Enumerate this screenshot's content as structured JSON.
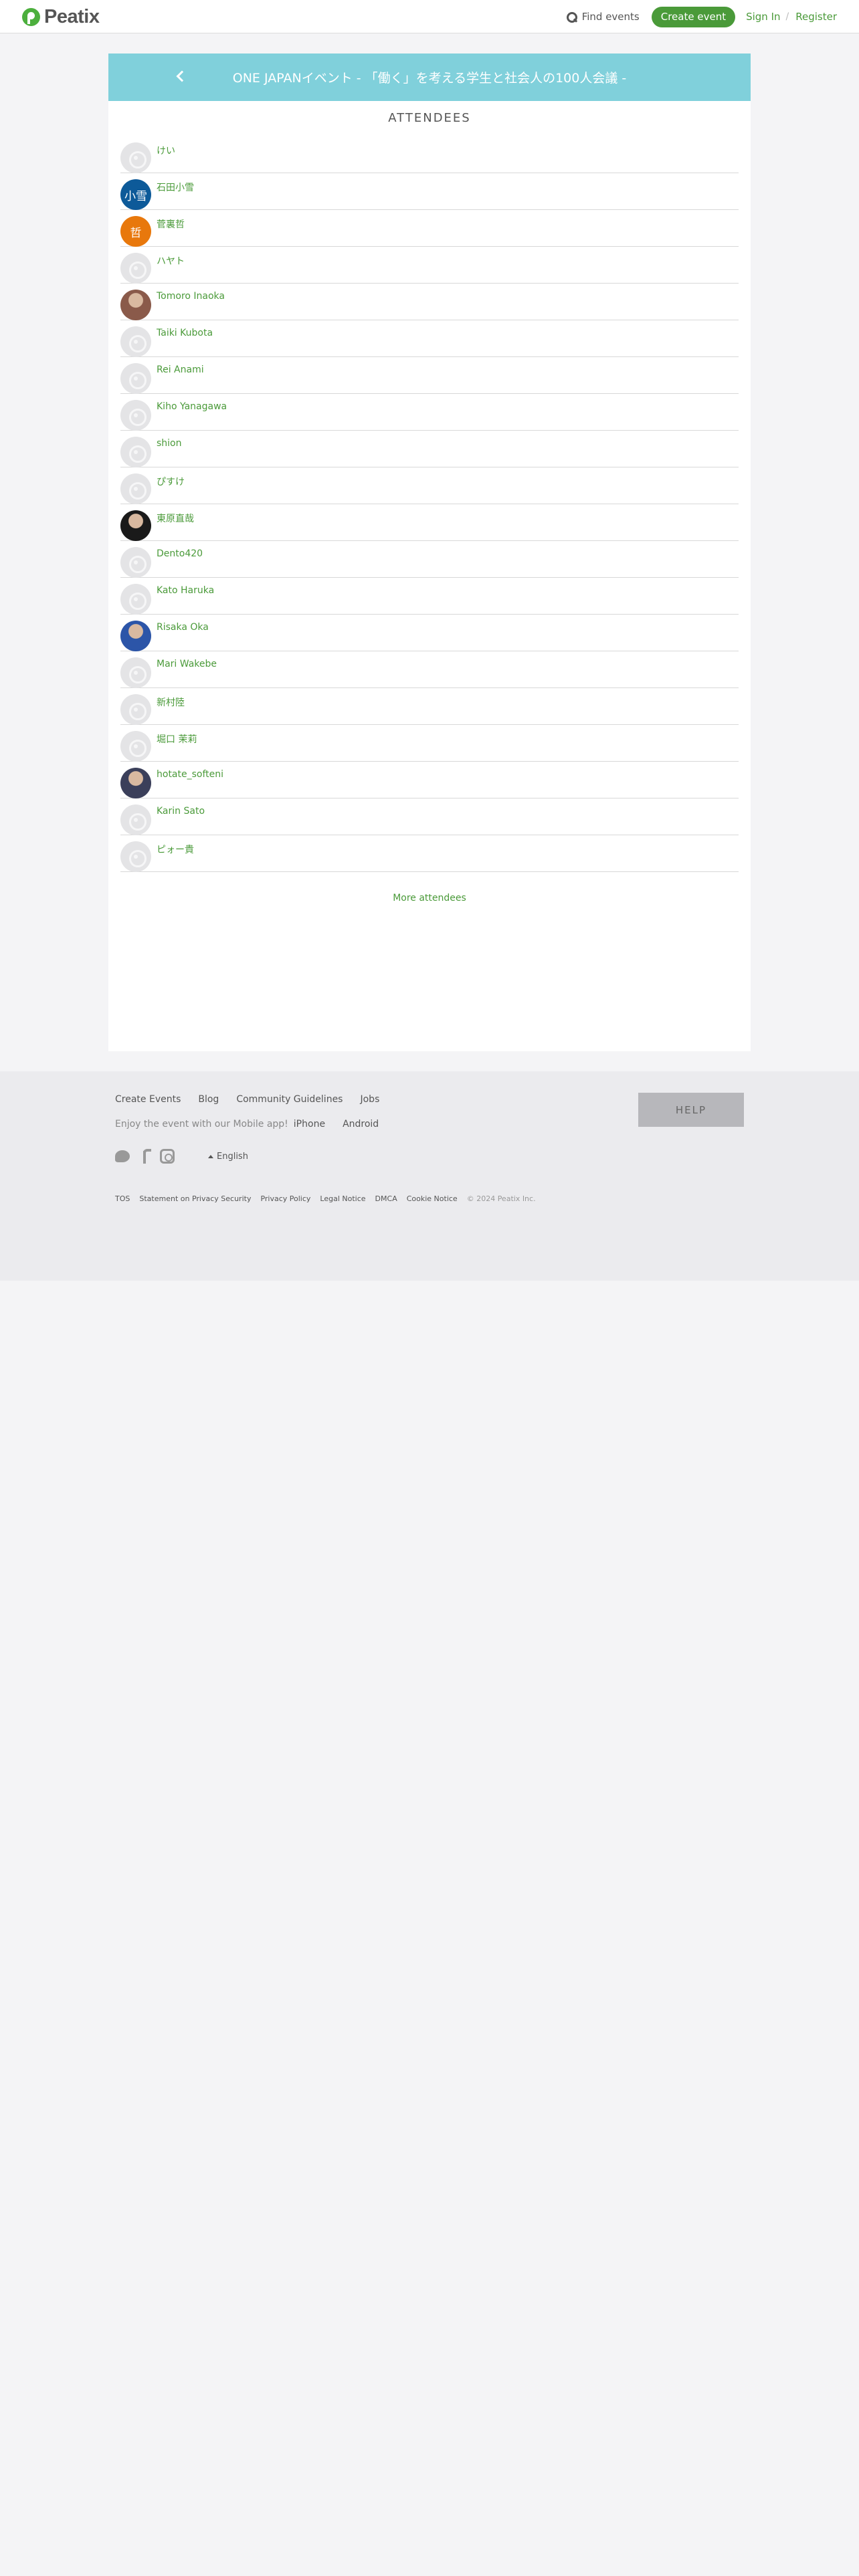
{
  "header": {
    "logo_text": "Peatix",
    "find_events": "Find events",
    "create_event": "Create event",
    "sign_in": "Sign In",
    "separator": "/",
    "register": "Register"
  },
  "event": {
    "title": "ONE JAPANイベント - 「働く」を考える学生と社会人の100人会議 -"
  },
  "attendees": {
    "heading": "ATTENDEES",
    "items": [
      {
        "name": "けい",
        "avatar": "default"
      },
      {
        "name": "石田小雪",
        "avatar": "initials",
        "initials": "小雪",
        "color": "#0d5a99"
      },
      {
        "name": "菅裏哲",
        "avatar": "initials",
        "initials": "哲",
        "color": "#e8780c"
      },
      {
        "name": "ハヤト",
        "avatar": "default"
      },
      {
        "name": "Tomoro Inaoka",
        "avatar": "photo",
        "color": "#8a5a4a"
      },
      {
        "name": "Taiki Kubota",
        "avatar": "default"
      },
      {
        "name": "Rei Anami",
        "avatar": "default"
      },
      {
        "name": "Kiho Yanagawa",
        "avatar": "default"
      },
      {
        "name": "shion",
        "avatar": "default"
      },
      {
        "name": "ぴすけ",
        "avatar": "default"
      },
      {
        "name": "東原直哉",
        "avatar": "photo",
        "color": "#1a1a1a"
      },
      {
        "name": "Dento420",
        "avatar": "default"
      },
      {
        "name": "Kato Haruka",
        "avatar": "default"
      },
      {
        "name": "Risaka Oka",
        "avatar": "photo",
        "color": "#2c55a8"
      },
      {
        "name": "Mari Wakebe",
        "avatar": "default"
      },
      {
        "name": "新村陸",
        "avatar": "default"
      },
      {
        "name": "堀口 茉莉",
        "avatar": "default"
      },
      {
        "name": "hotate_softeni",
        "avatar": "photo",
        "color": "#3b3f5a"
      },
      {
        "name": "Karin Sato",
        "avatar": "default"
      },
      {
        "name": "ピォー貴",
        "avatar": "default"
      }
    ],
    "more": "More attendees"
  },
  "footer": {
    "links": [
      "Create Events",
      "Blog",
      "Community Guidelines",
      "Jobs"
    ],
    "app_text": "Enjoy the event with our Mobile app!",
    "app_links": [
      "iPhone",
      "Android"
    ],
    "help": "HELP",
    "language": "English",
    "legal": [
      "TOS",
      "Statement on Privacy Security",
      "Privacy Policy",
      "Legal Notice",
      "DMCA",
      "Cookie Notice"
    ],
    "copyright": "© 2024 Peatix Inc."
  }
}
